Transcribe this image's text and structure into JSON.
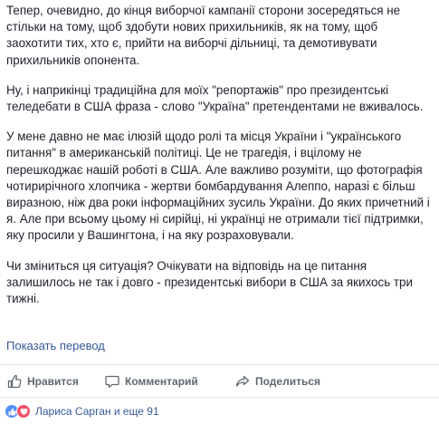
{
  "post": {
    "paragraphs": [
      "Тепер, очевидно, до кінця виборчої кампанії сторони зосередяться не стільки на тому, щоб здобути нових прихильників, як на тому, щоб заохотити тих, хто є, прийти на виборчі дільниці, та демотивувати прихильників опонента.",
      "Ну, і наприкінці традиційна для моїх \"репортажів\" про президентські теледебати в США фраза - слово \"Україна\" претендентами не вживалось.",
      "У мене давно не має ілюзій щодо ролі та місця України і \"українського питання\" в американській політиці. Це не трагедія, і вцілому не перешкоджає нашій роботі в США. Але важливо розуміти, що фотографія чотирирічного хлопчика - жертви бомбардування Алеппо, наразі є більш виразною, ніж два роки інформаційних зусиль України. До яких причетний і я. Але при всьому цьому ні сирійці, ні українці не отримали тієї підтримки, яку просили у Вашингтона, і на яку розраховували.",
      "Чи зміниться ця ситуація? Очікувати на відповідь на це питання залишилось не так і довго - президентські вибори в США за якихось три тижні."
    ],
    "see_translation": "Показать перевод"
  },
  "actions": {
    "like": {
      "label": "Нравится",
      "icon": "thumbs-up-icon"
    },
    "comment": {
      "label": "Комментарий",
      "icon": "comment-icon"
    },
    "share": {
      "label": "Поделиться",
      "icon": "share-icon"
    }
  },
  "reactions": {
    "icons": [
      "like-reaction-icon",
      "love-reaction-icon"
    ],
    "summary": "Лариса Сарган и еще 91"
  },
  "colors": {
    "text": "#1d2129",
    "link": "#365899",
    "action": "#606770",
    "like_blue": "#5890ff",
    "love_red": "#f25268"
  }
}
